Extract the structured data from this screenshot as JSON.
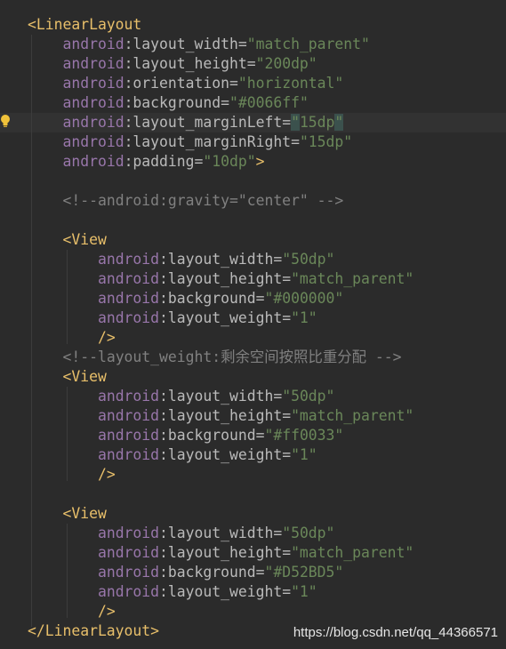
{
  "lines": [
    [
      {
        "t": "<LinearLayout",
        "c": "tag"
      }
    ],
    [
      {
        "t": "    "
      },
      {
        "t": "android",
        "c": "ns"
      },
      {
        "t": ":layout_width",
        "c": "attr"
      },
      {
        "t": "=",
        "c": "attr"
      },
      {
        "t": "\"match_parent\"",
        "c": "val"
      }
    ],
    [
      {
        "t": "    "
      },
      {
        "t": "android",
        "c": "ns"
      },
      {
        "t": ":layout_height",
        "c": "attr"
      },
      {
        "t": "=",
        "c": "attr"
      },
      {
        "t": "\"200dp\"",
        "c": "val"
      }
    ],
    [
      {
        "t": "    "
      },
      {
        "t": "android",
        "c": "ns"
      },
      {
        "t": ":orientation",
        "c": "attr"
      },
      {
        "t": "=",
        "c": "attr"
      },
      {
        "t": "\"horizontal\"",
        "c": "val"
      }
    ],
    [
      {
        "t": "    "
      },
      {
        "t": "android",
        "c": "ns"
      },
      {
        "t": ":background",
        "c": "attr"
      },
      {
        "t": "=",
        "c": "attr"
      },
      {
        "t": "\"#0066ff\"",
        "c": "val"
      }
    ],
    [
      {
        "t": "    "
      },
      {
        "t": "android",
        "c": "ns"
      },
      {
        "t": ":layout_marginLeft",
        "c": "attr"
      },
      {
        "t": "=",
        "c": "attr"
      },
      {
        "t": "\"",
        "c": "val caret-hl"
      },
      {
        "t": "15dp",
        "c": "val"
      },
      {
        "t": "\"",
        "c": "val caret-hl"
      }
    ],
    [
      {
        "t": "    "
      },
      {
        "t": "android",
        "c": "ns"
      },
      {
        "t": ":layout_marginRight",
        "c": "attr"
      },
      {
        "t": "=",
        "c": "attr"
      },
      {
        "t": "\"15dp\"",
        "c": "val"
      }
    ],
    [
      {
        "t": "    "
      },
      {
        "t": "android",
        "c": "ns"
      },
      {
        "t": ":padding",
        "c": "attr"
      },
      {
        "t": "=",
        "c": "attr"
      },
      {
        "t": "\"10dp\"",
        "c": "val"
      },
      {
        "t": ">",
        "c": "tag"
      }
    ],
    [],
    [
      {
        "t": "    "
      },
      {
        "t": "<!--android:gravity=\"center\" -->",
        "c": "cmt"
      }
    ],
    [],
    [
      {
        "t": "    "
      },
      {
        "t": "<View",
        "c": "tag"
      }
    ],
    [
      {
        "t": "        "
      },
      {
        "t": "android",
        "c": "ns"
      },
      {
        "t": ":layout_width",
        "c": "attr"
      },
      {
        "t": "=",
        "c": "attr"
      },
      {
        "t": "\"50dp\"",
        "c": "val"
      }
    ],
    [
      {
        "t": "        "
      },
      {
        "t": "android",
        "c": "ns"
      },
      {
        "t": ":layout_height",
        "c": "attr"
      },
      {
        "t": "=",
        "c": "attr"
      },
      {
        "t": "\"match_parent\"",
        "c": "val"
      }
    ],
    [
      {
        "t": "        "
      },
      {
        "t": "android",
        "c": "ns"
      },
      {
        "t": ":background",
        "c": "attr"
      },
      {
        "t": "=",
        "c": "attr"
      },
      {
        "t": "\"#000000\"",
        "c": "val"
      }
    ],
    [
      {
        "t": "        "
      },
      {
        "t": "android",
        "c": "ns"
      },
      {
        "t": ":layout_weight",
        "c": "attr"
      },
      {
        "t": "=",
        "c": "attr"
      },
      {
        "t": "\"1\"",
        "c": "val"
      }
    ],
    [
      {
        "t": "        "
      },
      {
        "t": "/>",
        "c": "tag"
      }
    ],
    [
      {
        "t": "    "
      },
      {
        "t": "<!--layout_weight:剩余空间按照比重分配 -->",
        "c": "cmt"
      }
    ],
    [
      {
        "t": "    "
      },
      {
        "t": "<View",
        "c": "tag"
      }
    ],
    [
      {
        "t": "        "
      },
      {
        "t": "android",
        "c": "ns"
      },
      {
        "t": ":layout_width",
        "c": "attr"
      },
      {
        "t": "=",
        "c": "attr"
      },
      {
        "t": "\"50dp\"",
        "c": "val"
      }
    ],
    [
      {
        "t": "        "
      },
      {
        "t": "android",
        "c": "ns"
      },
      {
        "t": ":layout_height",
        "c": "attr"
      },
      {
        "t": "=",
        "c": "attr"
      },
      {
        "t": "\"match_parent\"",
        "c": "val"
      }
    ],
    [
      {
        "t": "        "
      },
      {
        "t": "android",
        "c": "ns"
      },
      {
        "t": ":background",
        "c": "attr"
      },
      {
        "t": "=",
        "c": "attr"
      },
      {
        "t": "\"#ff0033\"",
        "c": "val"
      }
    ],
    [
      {
        "t": "        "
      },
      {
        "t": "android",
        "c": "ns"
      },
      {
        "t": ":layout_weight",
        "c": "attr"
      },
      {
        "t": "=",
        "c": "attr"
      },
      {
        "t": "\"1\"",
        "c": "val"
      }
    ],
    [
      {
        "t": "        "
      },
      {
        "t": "/>",
        "c": "tag"
      }
    ],
    [],
    [
      {
        "t": "    "
      },
      {
        "t": "<View",
        "c": "tag"
      }
    ],
    [
      {
        "t": "        "
      },
      {
        "t": "android",
        "c": "ns"
      },
      {
        "t": ":layout_width",
        "c": "attr"
      },
      {
        "t": "=",
        "c": "attr"
      },
      {
        "t": "\"50dp\"",
        "c": "val"
      }
    ],
    [
      {
        "t": "        "
      },
      {
        "t": "android",
        "c": "ns"
      },
      {
        "t": ":layout_height",
        "c": "attr"
      },
      {
        "t": "=",
        "c": "attr"
      },
      {
        "t": "\"match_parent\"",
        "c": "val"
      }
    ],
    [
      {
        "t": "        "
      },
      {
        "t": "android",
        "c": "ns"
      },
      {
        "t": ":background",
        "c": "attr"
      },
      {
        "t": "=",
        "c": "attr"
      },
      {
        "t": "\"#D52BD5\"",
        "c": "val"
      }
    ],
    [
      {
        "t": "        "
      },
      {
        "t": "android",
        "c": "ns"
      },
      {
        "t": ":layout_weight",
        "c": "attr"
      },
      {
        "t": "=",
        "c": "attr"
      },
      {
        "t": "\"1\"",
        "c": "val"
      }
    ],
    [
      {
        "t": "        "
      },
      {
        "t": "/>",
        "c": "tag"
      }
    ],
    [
      {
        "t": "</LinearLayout>",
        "c": "tag"
      }
    ]
  ],
  "current_line_index": 5,
  "watermark": "https://blog.csdn.net/qq_44366571",
  "colors": {
    "background": "#2b2b2b",
    "tag": "#e8bf6a",
    "namespace": "#9876aa",
    "attribute": "#bababa",
    "string": "#6a8759",
    "comment": "#808080"
  },
  "icons": {
    "gutter": "lightbulb-icon"
  }
}
